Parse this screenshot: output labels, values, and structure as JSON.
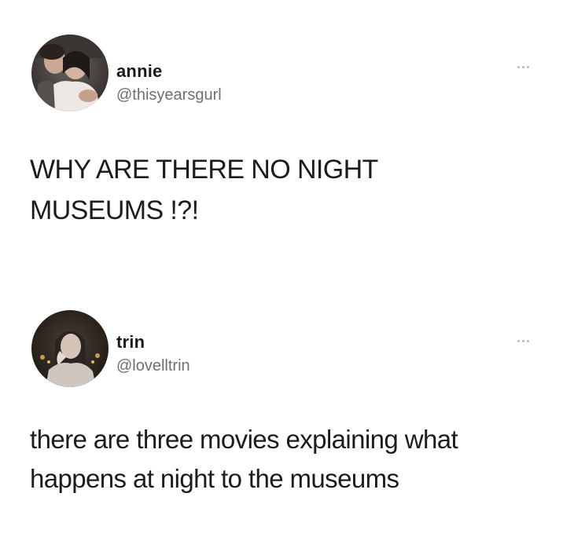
{
  "tweets": [
    {
      "name": "annie",
      "handle": "@thisyearsgurl",
      "text_lines": [
        "WHY ARE THERE NO NIGHT",
        "MUSEUMS !?!"
      ]
    },
    {
      "name": "trin",
      "handle": "@lovelltrin",
      "text_lines": [
        "there are three movies explaining what",
        "happens at night to the museums"
      ]
    }
  ],
  "icons": {
    "more": "more-horizontal-icon",
    "avatar": "profile-photo"
  }
}
